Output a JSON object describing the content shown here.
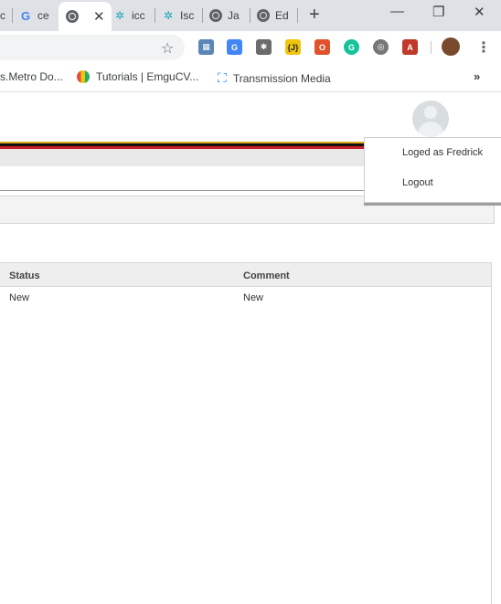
{
  "browser": {
    "tabs": [
      {
        "label": "c"
      },
      {
        "label": "ce"
      },
      {
        "label": ""
      },
      {
        "label": "icc"
      },
      {
        "label": "Isc"
      },
      {
        "label": "Ja"
      },
      {
        "label": "Ed"
      }
    ],
    "new_tab": "+",
    "window": {
      "minimize": "—",
      "restore": "❐",
      "close": "✕"
    },
    "extensions": [
      "Table",
      "Google Translate",
      "HubSpot",
      "{JF}",
      "Office",
      "Grammarly",
      "Film",
      "PDF"
    ],
    "bookmarks": [
      {
        "label": "s.Metro Do..."
      },
      {
        "label": "Tutorials | EmguCV..."
      },
      {
        "label": "Transmission Media"
      }
    ],
    "more_bookmarks": "»"
  },
  "user_menu": {
    "logged_as": "Loged as Fredrick",
    "logout": "Logout"
  },
  "table": {
    "columns": [
      "Status",
      "Comment"
    ],
    "rows": [
      {
        "status": "New",
        "comment": "New"
      }
    ]
  },
  "colors": {
    "stripe_gold": "#e3a91b",
    "stripe_black": "#111111",
    "stripe_red": "#c81d25",
    "tab_bar": "#dee1e6"
  }
}
